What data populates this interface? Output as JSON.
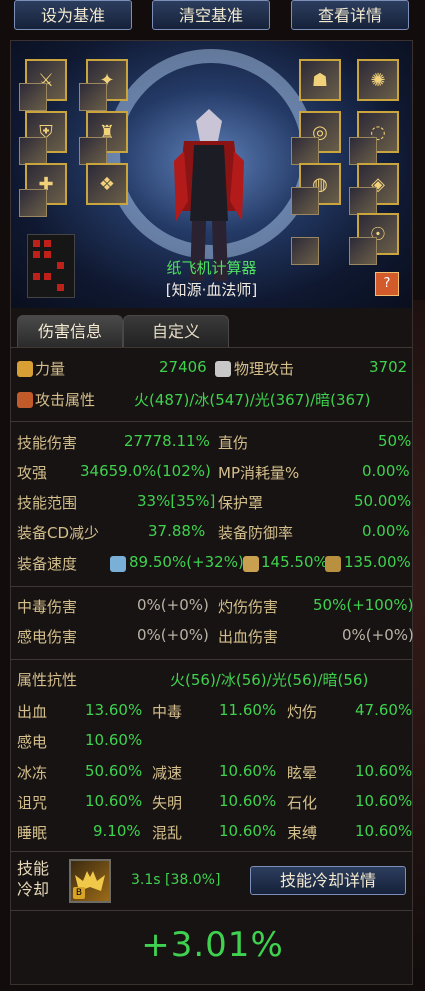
{
  "toolbar": {
    "set_baseline": "设为基准",
    "clear_baseline": "清空基准",
    "view_details": "查看详情"
  },
  "character": {
    "name": "纸飞机计算器",
    "title": "[知源·血法师]"
  },
  "tabs": [
    {
      "label": "伤害信息",
      "active": true
    },
    {
      "label": "自定义",
      "active": false
    }
  ],
  "stats_main": {
    "strength_label": "力量",
    "strength_value": "27406",
    "phys_atk_label": "物理攻击",
    "phys_atk_value": "3702",
    "atk_attr_label": "攻击属性",
    "atk_attr_value": "火(487)/冰(547)/光(367)/暗(367)"
  },
  "stats_damage": [
    {
      "l1": "技能伤害",
      "v1": "27778.11%",
      "l2": "直伤",
      "v2": "50%"
    },
    {
      "l1": "攻强",
      "v1": "34659.0%(102%)",
      "l2": "MP消耗量%",
      "v2": "0.00%"
    },
    {
      "l1": "技能范围",
      "v1": "33%[35%]",
      "l2": "保护罩",
      "v2": "50.00%"
    },
    {
      "l1": "装备CD减少",
      "v1": "37.88%",
      "l2": "装备防御率",
      "v2": "0.00%"
    }
  ],
  "equip_speed": {
    "label": "装备速度",
    "v1": "89.50%(+32%)",
    "v2": "145.50%",
    "v3": "135.00%"
  },
  "dot_damage": [
    {
      "l1": "中毒伤害",
      "v1": "0%(+0%)",
      "l2": "灼伤伤害",
      "v2": "50%(+100%)"
    },
    {
      "l1": "感电伤害",
      "v1": "0%(+0%)",
      "l2": "出血伤害",
      "v2": "0%(+0%)"
    }
  ],
  "resist": {
    "label": "属性抗性",
    "value": "火(56)/冰(56)/光(56)/暗(56)"
  },
  "status_resist": [
    [
      {
        "l": "出血",
        "v": "13.60%"
      },
      {
        "l": "中毒",
        "v": "11.60%"
      },
      {
        "l": "灼伤",
        "v": "47.60%"
      }
    ],
    [
      {
        "l": "感电",
        "v": "10.60%"
      }
    ],
    [
      {
        "l": "冰冻",
        "v": "50.60%"
      },
      {
        "l": "减速",
        "v": "10.60%"
      },
      {
        "l": "眩晕",
        "v": "10.60%"
      }
    ],
    [
      {
        "l": "诅咒",
        "v": "10.60%"
      },
      {
        "l": "失明",
        "v": "10.60%"
      },
      {
        "l": "石化",
        "v": "10.60%"
      }
    ],
    [
      {
        "l": "睡眠",
        "v": "9.10%"
      },
      {
        "l": "混乱",
        "v": "10.60%"
      },
      {
        "l": "束缚",
        "v": "10.60%"
      }
    ]
  ],
  "cooldown": {
    "label_line1": "技能",
    "label_line2": "冷却",
    "value": "3.1s [38.0%]",
    "button": "技能冷却详情"
  },
  "result": "+3.01%",
  "icons": {
    "strength": "fist-icon",
    "phys_atk": "sword-icon",
    "atk_attr": "element-icon",
    "speed1": "quill-icon",
    "speed2": "runner-icon",
    "speed3": "swords-icon",
    "skill": "bat-skill-icon",
    "help": "question-book-icon"
  },
  "colors": {
    "label": "#d4bf8c",
    "value": "#3fd24f",
    "name_green": "#4fe060",
    "button_bg": "#1e2c4a"
  }
}
